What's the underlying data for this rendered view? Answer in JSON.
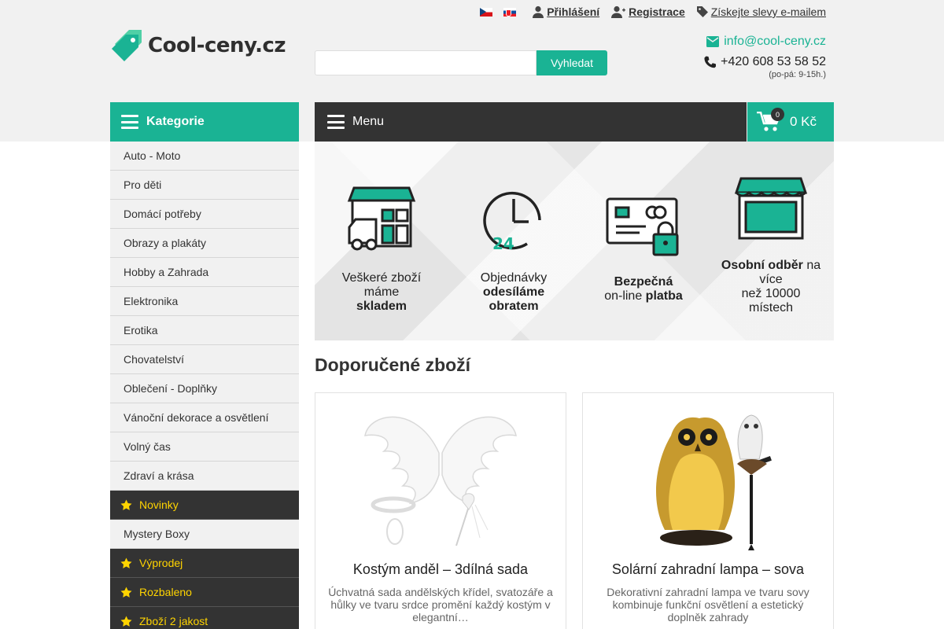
{
  "header": {
    "logo_text": "Cool-ceny.cz",
    "flags": [
      "CZ",
      "SK"
    ],
    "login_label": "Přihlášení",
    "register_label": "Registrace",
    "discount_label": "Získejte slevy e-mailem",
    "search": {
      "placeholder": "",
      "button_label": "Vyhledat"
    },
    "contact": {
      "email": "info@cool-ceny.cz",
      "phone": "+420 608 53 58 52",
      "hours": "(po-pá: 9-15h.)"
    }
  },
  "nav": {
    "categories_label": "Kategorie",
    "menu_label": "Menu",
    "cart_count": "0",
    "cart_total": "0 Kč"
  },
  "sidebar": {
    "items": [
      {
        "label": "Auto - Moto",
        "highlighted": false
      },
      {
        "label": "Pro děti",
        "highlighted": false
      },
      {
        "label": "Domácí potřeby",
        "highlighted": false
      },
      {
        "label": "Obrazy a plakáty",
        "highlighted": false
      },
      {
        "label": "Hobby a Zahrada",
        "highlighted": false
      },
      {
        "label": "Elektronika",
        "highlighted": false
      },
      {
        "label": "Erotika",
        "highlighted": false
      },
      {
        "label": "Chovatelství",
        "highlighted": false
      },
      {
        "label": "Oblečení - Doplňky",
        "highlighted": false
      },
      {
        "label": "Vánoční dekorace a osvětlení",
        "highlighted": false
      },
      {
        "label": "Volný čas",
        "highlighted": false
      },
      {
        "label": "Zdraví a krása",
        "highlighted": false
      },
      {
        "label": "Novinky",
        "highlighted": true
      },
      {
        "label": "Mystery Boxy",
        "highlighted": false
      },
      {
        "label": "Výprodej",
        "highlighted": true
      },
      {
        "label": "Rozbaleno",
        "highlighted": true
      },
      {
        "label": "Zboží 2 jakost",
        "highlighted": true
      }
    ]
  },
  "benefits": [
    {
      "icon": "warehouse-truck-icon",
      "line1": "Veškeré zboží",
      "line2": "máme",
      "bold": "skladem"
    },
    {
      "icon": "clock-24-icon",
      "line1": "Objednávky",
      "bold1": "odesíláme",
      "bold2": "obratem"
    },
    {
      "icon": "secure-card-icon",
      "bold1": "Bezpečná",
      "line2": "on-line",
      "bold2": "platba"
    },
    {
      "icon": "shop-icon",
      "bold1": "Osobní odběr",
      "line1": "na",
      "line2": "více",
      "line3": "než 10000",
      "line4": "místech"
    }
  ],
  "recommended": {
    "title": "Doporučené zboží",
    "products": [
      {
        "name": "Kostým anděl – 3dílná sada",
        "description": "Úchvatná sada andělských křídel, svatozáře a hůlky ve tvaru srdce promění každý kostým v elegantní…"
      },
      {
        "name": "Solární zahradní lampa – sova",
        "description": "Dekorativní zahradní lampa ve tvaru sovy kombinuje funkční osvětlení a estetický doplněk zahrady"
      }
    ]
  },
  "colors": {
    "accent": "#1ab394",
    "dark": "#333333",
    "highlight_text": "#ffd400",
    "band": "#f1f1f1"
  }
}
